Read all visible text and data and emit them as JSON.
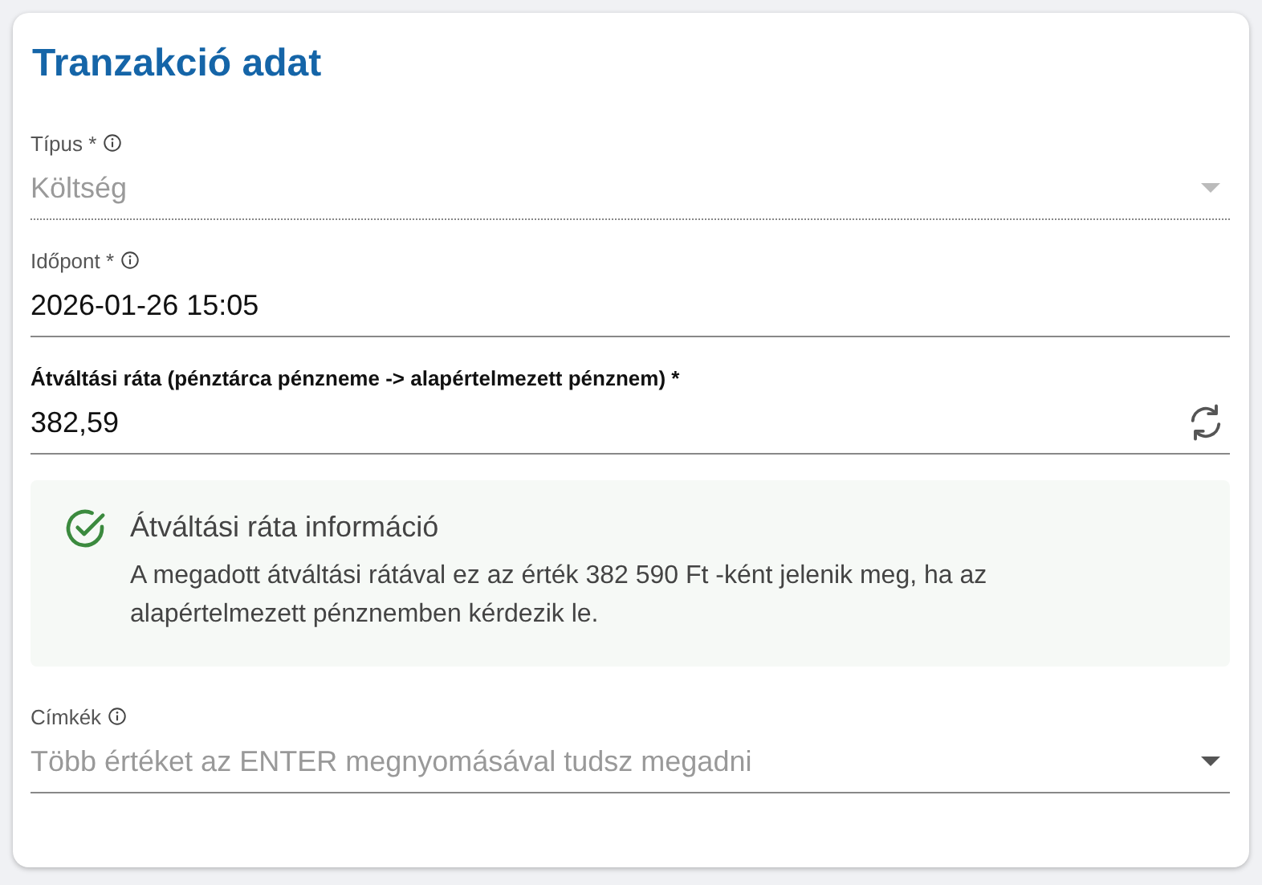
{
  "card": {
    "title": "Tranzakció adat"
  },
  "items": [
    {
      "kind": "select",
      "label": "Típus *",
      "info": true,
      "label_bold": false,
      "value": "Költség",
      "disabled": true
    },
    {
      "kind": "input",
      "label": "Időpont *",
      "info": true,
      "label_bold": false,
      "value": "2026-01-26 15:05",
      "disabled": false
    },
    {
      "kind": "refresh-input",
      "label": "Átváltási ráta (pénztárca pénzneme -> alapértelmezett pénznem) *",
      "info": false,
      "label_bold": true,
      "value": "382,59",
      "disabled": false
    },
    {
      "kind": "alert",
      "title": "Átváltási ráta információ",
      "text": "A megadott átváltási rátával ez az érték 382 590 Ft -ként jelenik meg, ha az alapértelmezett pénznemben kérdezik le."
    },
    {
      "kind": "select",
      "label": "Címkék",
      "info": true,
      "label_bold": false,
      "placeholder": "Több értéket az ENTER megnyomásával tudsz megadni",
      "disabled": false
    }
  ]
}
